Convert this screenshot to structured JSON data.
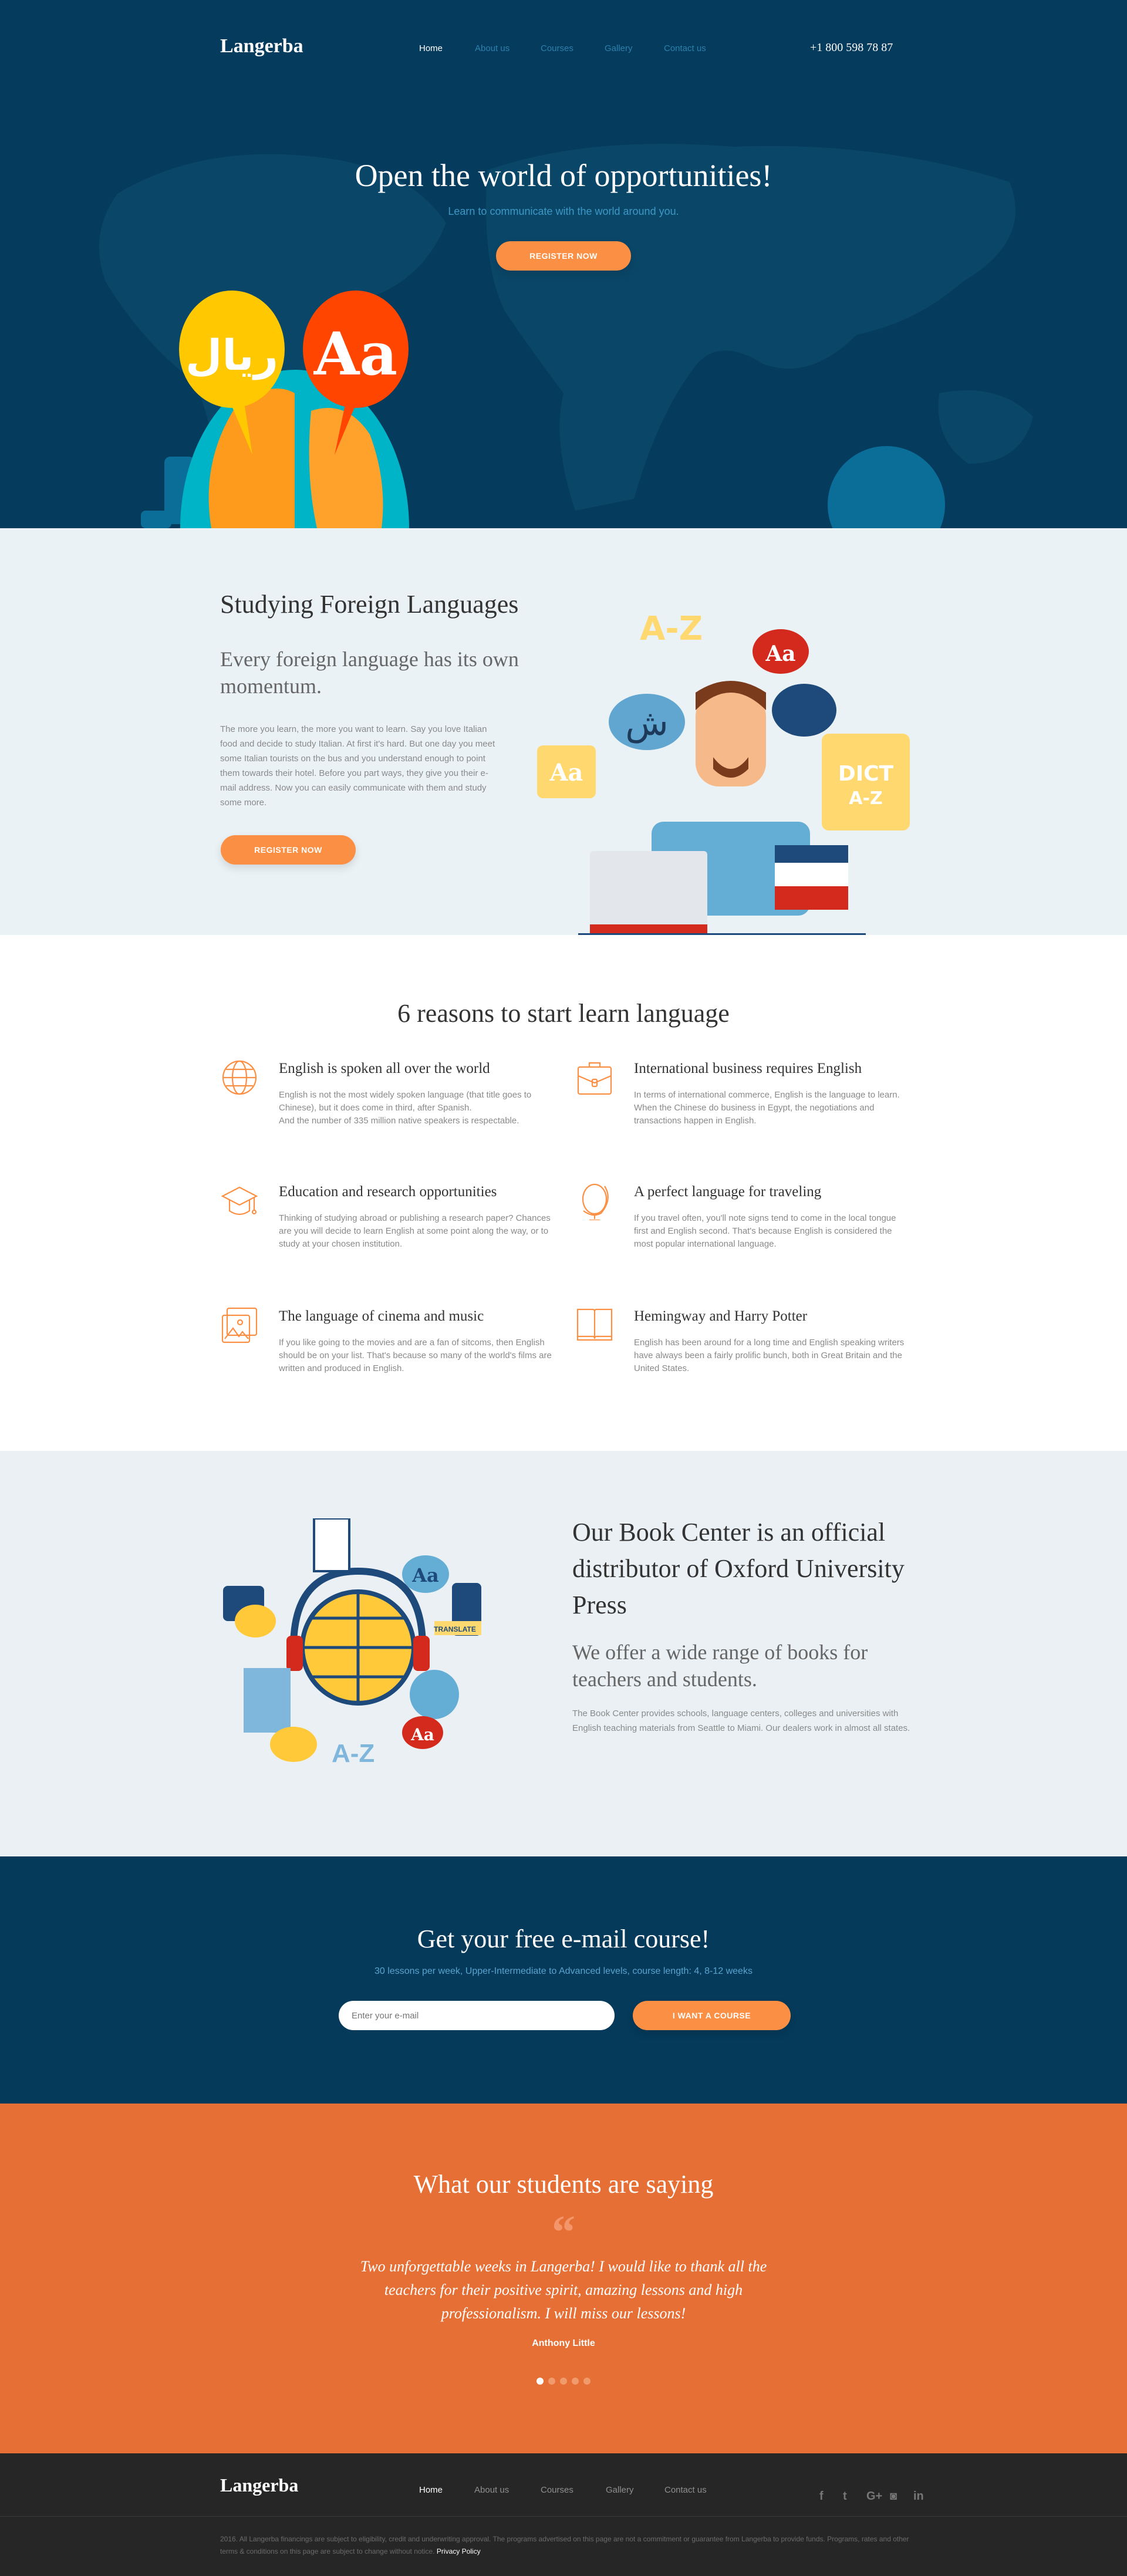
{
  "header": {
    "logo": "Langerba",
    "nav": [
      "Home",
      "About us",
      "Courses",
      "Gallery",
      "Contact us"
    ],
    "phone": "+1 800 598 78 87"
  },
  "hero": {
    "title": "Open the world of opportunities!",
    "subtitle": "Learn to communicate with the world around you.",
    "button": "REGISTER NOW",
    "bubble_left": "ريال",
    "bubble_right": "Aa"
  },
  "study": {
    "title": "Studying Foreign Languages",
    "subtitle": "Every foreign language has its own momentum.",
    "body": "The more you learn, the more you want to learn. Say you love Italian food and decide to study Italian. At first it's hard. But one day you meet some Italian tourists on the bus and you understand enough to point them towards their hotel. Before you part ways, they give you their e-mail address. Now you can easily communicate with them and study some more.",
    "button": "REGISTER NOW",
    "illus": {
      "az": "A-Z",
      "aa": "Aa",
      "dict": "DICT",
      "dict_az": "A-Z",
      "shin": "ش"
    }
  },
  "reasons": {
    "title": "6 reasons to start learn language",
    "items": [
      {
        "icon": "globe-icon",
        "title": "English is spoken all over the world",
        "body": "English is not the most widely spoken language (that title goes to Chinese), but it does come in third, after Spanish.\nAnd the number of 335 million native speakers is respectable."
      },
      {
        "icon": "briefcase-icon",
        "title": "International business requires English",
        "body": "In terms of international commerce, English is the language to learn. When the Chinese do business in Egypt, the negotiations and transactions happen in English."
      },
      {
        "icon": "graduation-cap-icon",
        "title": "Education and research opportunities",
        "body": "Thinking of studying abroad or publishing a research paper? Chances are you will decide to learn English at some point along the way, or to study at your chosen institution."
      },
      {
        "icon": "desk-globe-icon",
        "title": "A perfect language for traveling",
        "body": "If you travel often, you'll note signs tend to come in the local tongue first and English second. That's because English is considered the most popular international language."
      },
      {
        "icon": "picture-icon",
        "title": "The language of cinema and music",
        "body": "If you like going to the movies and are a fan of sitcoms, then English should be on your list. That's because so many of the world's films are written and produced in English."
      },
      {
        "icon": "book-icon",
        "title": "Hemingway and Harry Potter",
        "body": "English has been around for a long time and English speaking writers have always been a fairly prolific bunch, both in Great Britain and the United States."
      }
    ]
  },
  "books": {
    "title": "Our Book Center is an official distributor of Oxford University Press",
    "subtitle": "We offer a wide range of books for teachers and students.",
    "body": "The Book Center provides schools, language centers, colleges and universities with English teaching materials from Seattle to Miami. Our dealers work in almost all states.",
    "illus": {
      "aa": "Aa",
      "az": "A-Z",
      "translate": "TRANSLATE"
    }
  },
  "mail": {
    "title": "Get your free e-mail course!",
    "subtitle": "30 lessons per week, Upper-Intermediate to Advanced levels, course length: 4, 8-12 weeks",
    "placeholder": "Enter your e-mail",
    "button": "I WANT A COURSE"
  },
  "testimonials": {
    "title": "What our students are saying",
    "quote_mark": "“",
    "quote": "Two unforgettable weeks in Langerba! I would like to thank all the teachers for their positive spirit, amazing lessons and high professionalism. I will miss our lessons!",
    "author": "Anthony Little",
    "slides": 5,
    "active_slide": 1
  },
  "footer": {
    "logo": "Langerba",
    "nav": [
      "Home",
      "About us",
      "Courses",
      "Gallery",
      "Contact us"
    ],
    "social": [
      "facebook-icon",
      "twitter-icon",
      "google-plus-icon",
      "instagram-icon",
      "linkedin-icon"
    ],
    "social_glyphs": [
      "f",
      "t",
      "G+",
      "◙",
      "in"
    ],
    "copyright": "2016. All Langerba financings are subject to eligibility, credit and underwriting approval. The programs advertised on this page are not a commitment or guarantee from Langerba to provide funds. Programs, rates and other terms & conditions on this page are subject to change without notice.",
    "privacy": "Privacy Policy"
  },
  "colors": {
    "navy": "#053b5c",
    "orange": "#fb8f43",
    "testimonial_bg": "#e66f35",
    "light_bg": "#eaf2f6",
    "footer_bg": "#262626"
  }
}
